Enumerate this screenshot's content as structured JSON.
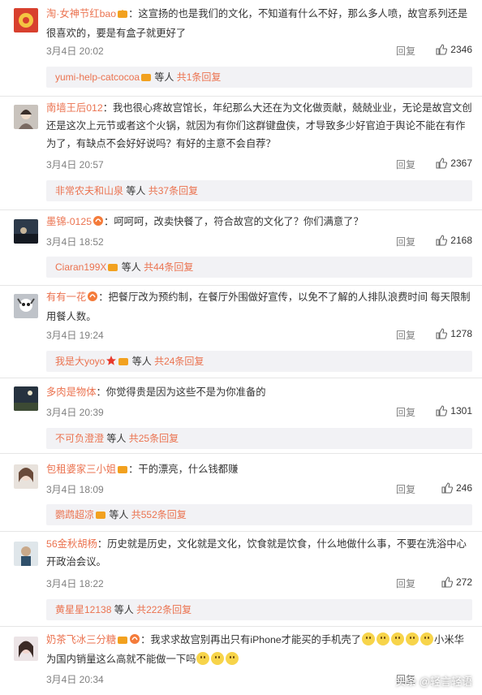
{
  "comments": [
    {
      "user": "淘·女神节红bao",
      "text": "：这宣扬的也是我们的文化，不知道有什么不好，那么多人喷，故宫系列还是很喜欢的，要是有盒子就更好了",
      "date": "3月4日 20:02",
      "reply": "回复",
      "likes": "2346",
      "sub": {
        "user": "yumi-help-catcocoa",
        "mid": "等人",
        "count": "共1条回复"
      }
    },
    {
      "user": "南墙王后012",
      "text": "：我也很心疼故宫馆长，年纪那么大还在为文化做贡献，兢兢业业，无论是故宫文创还是这次上元节或者这个火锅，就因为有你们这群键盘侠，才导致多少好官迫于舆论不能在有作为了，有缺点不会好好说吗？有好的主意不会自荐？",
      "date": "3月4日 20:57",
      "reply": "回复",
      "likes": "2367",
      "sub": {
        "user": "非常农夫和山泉",
        "mid": "等人",
        "count": "共37条回复"
      }
    },
    {
      "user": "墨锦-0125",
      "text": "：呵呵呵，改卖快餐了，符合故宫的文化了？你们满意了？",
      "date": "3月4日 18:52",
      "reply": "回复",
      "likes": "2168",
      "sub": {
        "user": "Ciaran199X",
        "mid": "等人",
        "count": "共44条回复"
      }
    },
    {
      "user": "有有一花",
      "text": "：把餐厅改为预约制，在餐厅外围做好宣传，以免不了解的人排队浪费时间   每天限制用餐人数。",
      "date": "3月4日 19:24",
      "reply": "回复",
      "likes": "1278",
      "sub": {
        "user": "我是大yoyo",
        "mid": "等人",
        "count": "共24条回复"
      }
    },
    {
      "user": "多肉是物体",
      "text": "：你觉得贵是因为这些不是为你准备的",
      "date": "3月4日 20:39",
      "reply": "回复",
      "likes": "1301",
      "sub": {
        "user": "不可负澄澄",
        "mid": "等人",
        "count": "共25条回复"
      }
    },
    {
      "user": "包租婆家三小姐",
      "text": "：干的漂亮，什么钱都赚",
      "date": "3月4日 18:09",
      "reply": "回复",
      "likes": "246",
      "sub": {
        "user": "鹦鹉超凉",
        "mid": "等人",
        "count": "共552条回复"
      }
    },
    {
      "user": "56金秋胡杨",
      "text": "：历史就是历史，文化就是文化，饮食就是饮食，什么地做什么事，不要在洗浴中心开政治会议。",
      "date": "3月4日 18:22",
      "reply": "回复",
      "likes": "272",
      "sub": {
        "user": "黄星星12138",
        "mid": "等人",
        "count": "共222条回复"
      }
    },
    {
      "user": "奶茶飞冰三分糖",
      "text_a": "：我求求故宫别再出只有iPhone才能买的手机壳了",
      "text_b": "小米华为国内销量这么高就不能做一下吗",
      "date": "3月4日 20:34",
      "reply": "回复"
    }
  ],
  "watermark": "头条 @轻言轻语"
}
